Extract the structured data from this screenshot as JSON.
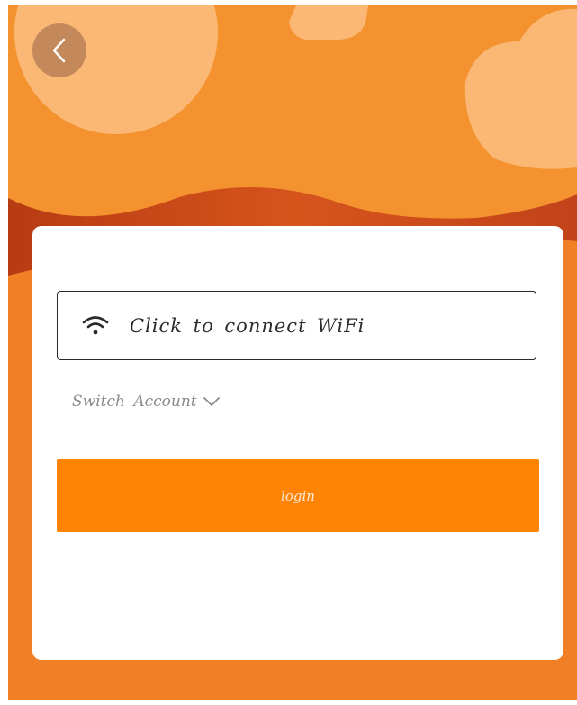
{
  "colors": {
    "background": "#f08a2e",
    "card": "#ffffff",
    "accent": "#ff8405",
    "dark_wave": "#c8461a",
    "light_shape": "#fbb774"
  },
  "header": {
    "back_icon": "chevron-left-icon"
  },
  "wifi": {
    "icon": "wifi-icon",
    "label": "Click to connect WiFi"
  },
  "account": {
    "switch_label": "Switch Account",
    "icon": "chevron-down-icon"
  },
  "login": {
    "label": "login"
  }
}
